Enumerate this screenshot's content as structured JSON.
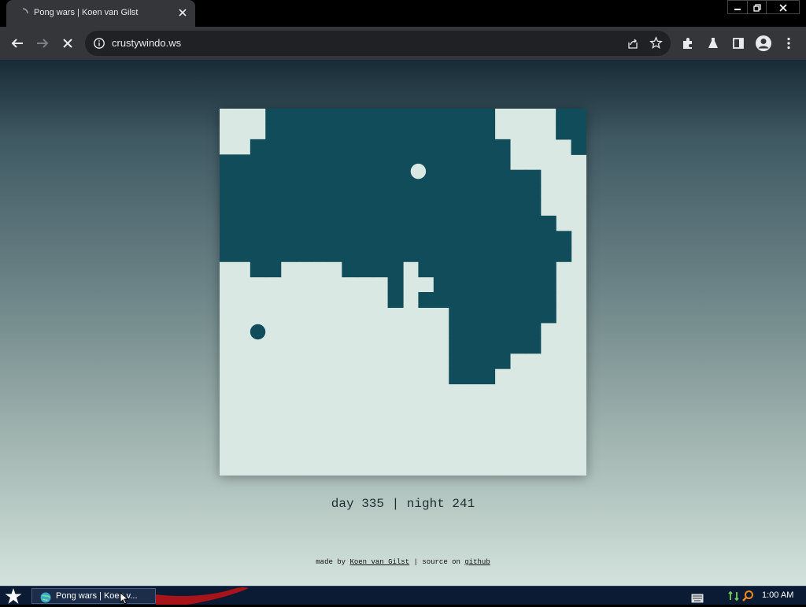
{
  "tab": {
    "title": "Pong wars | Koen van Gilst"
  },
  "omnibox": {
    "url": "crustywindo.ws"
  },
  "game": {
    "day_color": "#d9e8e3",
    "night_color": "#114c5a",
    "grid": {
      "cols": 24,
      "rows": 24
    },
    "night_rows": [
      [
        3,
        17
      ],
      [
        3,
        17
      ],
      [
        3,
        18
      ],
      [
        0,
        18
      ],
      [
        0,
        20
      ],
      [
        0,
        20
      ],
      [
        0,
        20
      ],
      [
        0,
        21
      ],
      [
        0,
        22
      ],
      [
        0,
        22
      ],
      [
        2,
        3,
        8,
        21
      ],
      [
        11,
        12,
        14,
        21
      ],
      [
        11,
        11,
        13,
        21
      ],
      [
        15,
        21
      ],
      [
        15,
        20
      ],
      [
        15,
        20
      ],
      [
        15,
        18
      ],
      [
        15,
        17
      ]
    ],
    "night_extra": [
      [
        22,
        0
      ],
      [
        23,
        0
      ],
      [
        22,
        1
      ],
      [
        23,
        1
      ],
      [
        23,
        2
      ],
      [
        2,
        2
      ],
      [
        2,
        3
      ],
      [
        1,
        3
      ]
    ],
    "day_holes": [
      [
        12,
        10
      ],
      [
        12,
        11
      ]
    ],
    "day_ball": {
      "col": 12.5,
      "row": 3.6
    },
    "night_ball": {
      "col": 2.0,
      "row": 14.1
    },
    "day_count": 335,
    "night_count": 241
  },
  "score": {
    "text": "day 335 | night 241"
  },
  "footer": {
    "prefix": "made by ",
    "author": "Koen van Gilst",
    "middle": " | source on ",
    "source": "github"
  },
  "taskbar": {
    "task_label": "Pong wars | Koen v...",
    "clock": "1:00 AM"
  }
}
